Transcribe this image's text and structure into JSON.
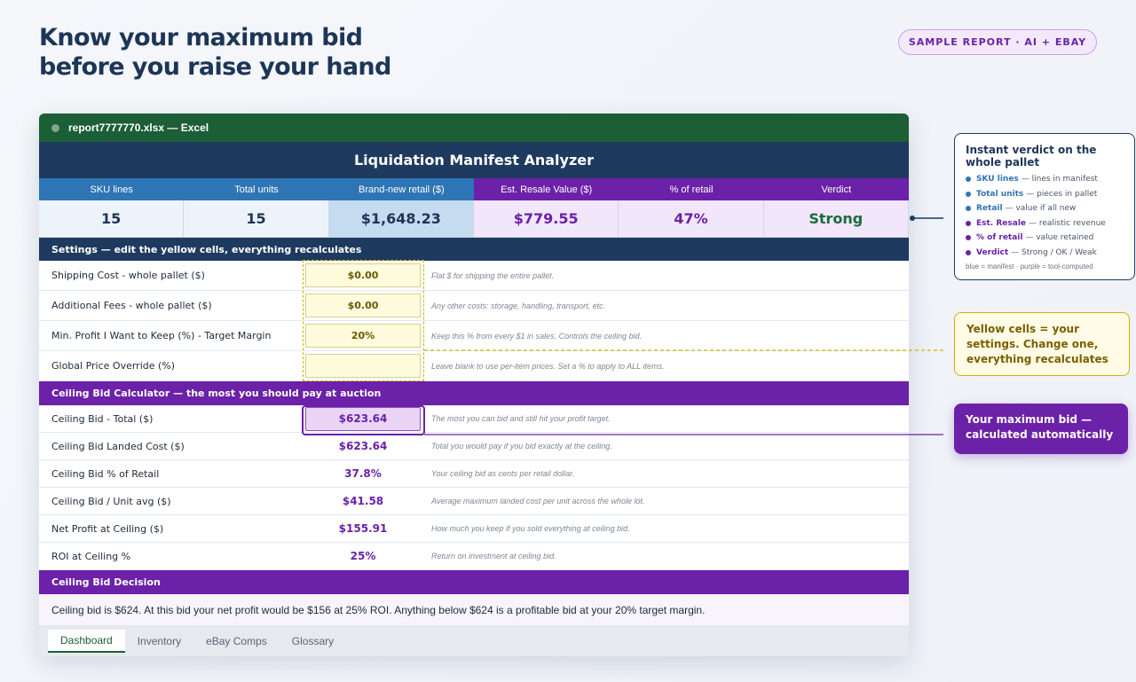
{
  "headline": {
    "line1": "Know your maximum bid",
    "line2": "before you raise your hand"
  },
  "badge": "SAMPLE REPORT · AI + EBAY",
  "window": {
    "title": "report7777770.xlsx — Excel",
    "app_title": "Liquidation Manifest Analyzer"
  },
  "kpis": {
    "headers": [
      "SKU lines",
      "Total units",
      "Brand-new retail ($)",
      "Est. Resale Value ($)",
      "% of retail",
      "Verdict"
    ],
    "values": [
      "15",
      "15",
      "$1,648.23",
      "$779.55",
      "47%",
      "Strong"
    ]
  },
  "settings": {
    "header": "Settings — edit the yellow cells, everything recalculates",
    "rows": [
      {
        "label": "Shipping Cost - whole pallet ($)",
        "value": "$0.00",
        "note": "Flat $ for shipping the entire pallet."
      },
      {
        "label": "Additional Fees - whole pallet ($)",
        "value": "$0.00",
        "note": "Any other costs: storage, handling, transport, etc."
      },
      {
        "label": "Min. Profit I Want to Keep (%) - Target Margin",
        "value": "20%",
        "note": "Keep this % from every $1 in sales. Controls the ceiling bid."
      },
      {
        "label": "Global Price Override (%)",
        "value": "",
        "note": "Leave blank to use per-item prices. Set a % to apply to ALL items."
      }
    ]
  },
  "calculator": {
    "header": "Ceiling Bid Calculator — the most you should pay at auction",
    "rows": [
      {
        "label": "Ceiling Bid - Total ($)",
        "value": "$623.64",
        "note": "The most you can bid and still hit your profit target."
      },
      {
        "label": "Ceiling Bid Landed Cost ($)",
        "value": "$623.64",
        "note": "Total you would pay if you bid exactly at the ceiling."
      },
      {
        "label": "Ceiling Bid % of Retail",
        "value": "37.8%",
        "note": "Your ceiling bid as cents per retail dollar."
      },
      {
        "label": "Ceiling Bid / Unit avg ($)",
        "value": "$41.58",
        "note": "Average maximum landed cost per unit across the whole lot."
      },
      {
        "label": "Net Profit at Ceiling ($)",
        "value": "$155.91",
        "note": "How much you keep if you sold everything at ceiling bid."
      },
      {
        "label": "ROI at Ceiling %",
        "value": "25%",
        "note": "Return on investment at ceiling bid."
      }
    ]
  },
  "decision": {
    "header": "Ceiling Bid Decision",
    "text": "Ceiling bid is $624. At this bid your net profit would be $156 at 25% ROI. Anything below $624 is a profitable bid at your 20% target margin."
  },
  "tabs": [
    "Dashboard",
    "Inventory",
    "eBay Comps",
    "Glossary"
  ],
  "legend_callout": {
    "title": "Instant verdict on the whole pallet",
    "items": [
      {
        "key": "SKU lines",
        "desc": "— lines in manifest",
        "color": "#2e75b6"
      },
      {
        "key": "Total units",
        "desc": "— pieces in pallet",
        "color": "#2e75b6"
      },
      {
        "key": "Retail",
        "desc": "— value if all new",
        "color": "#2e75b6"
      },
      {
        "key": "Est. Resale",
        "desc": "— realistic revenue",
        "color": "#6b21a8"
      },
      {
        "key": "% of retail",
        "desc": "— value retained",
        "color": "#6b21a8"
      },
      {
        "key": "Verdict",
        "desc": "— Strong / OK / Weak",
        "color": "#6b21a8"
      }
    ],
    "footer": "blue = manifest · purple = tool-computed"
  },
  "yellow_callout": "Yellow cells = your settings. Change one, everything recalculates",
  "purple_callout": "Your maximum bid — calculated automatically",
  "colors": {
    "excel_green": "#1c5e35",
    "navy": "#1e3a5f",
    "purple": "#6b21a8",
    "blue": "#2e75b6",
    "yellow": "#fffbdd"
  }
}
